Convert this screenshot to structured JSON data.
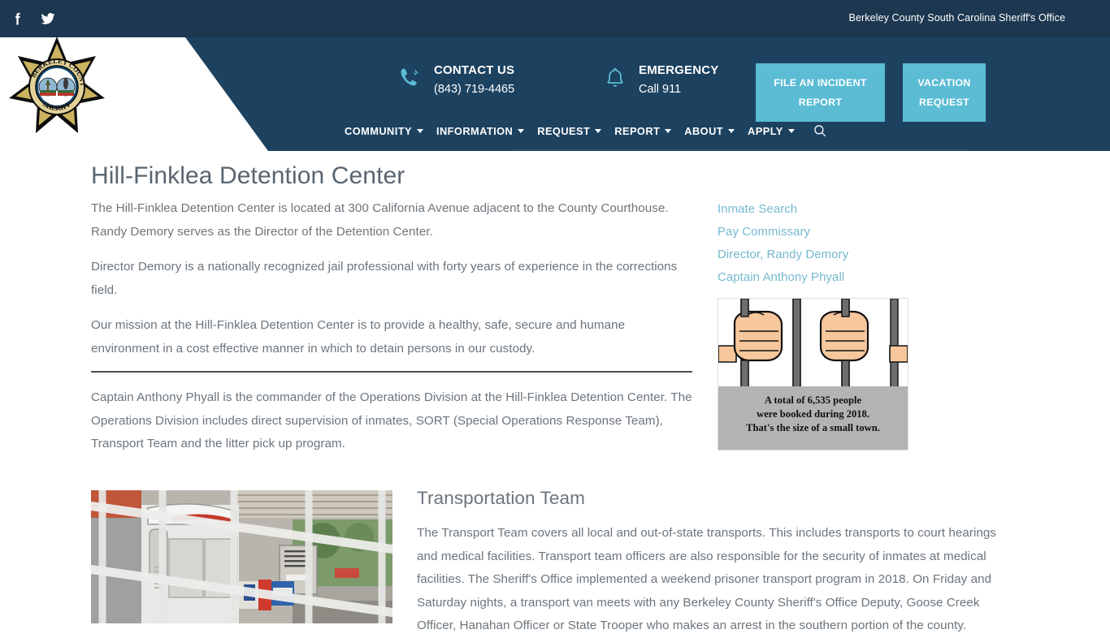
{
  "topbar": {
    "site_title": "Berkeley County South Carolina Sheriff's Office",
    "social": [
      {
        "name": "facebook-icon",
        "label": "Facebook"
      },
      {
        "name": "twitter-icon",
        "label": "Twitter"
      }
    ]
  },
  "header": {
    "logo_alt": "Berkeley County Sheriff Badge",
    "contact": {
      "heading": "CONTACT US",
      "phone": "(843) 719-4465",
      "icon": "phone-icon"
    },
    "emergency": {
      "heading": "EMERGENCY",
      "sub": "Call 911",
      "icon": "bell-icon"
    },
    "buttons": [
      {
        "label": "FILE AN INCIDENT REPORT",
        "color": "#5bbcd4"
      },
      {
        "label": "VACATION REQUEST",
        "color": "#5bbcd4"
      }
    ],
    "nav": [
      {
        "label": "COMMUNITY",
        "has_caret": true
      },
      {
        "label": "INFORMATION",
        "has_caret": true
      },
      {
        "label": "REQUEST",
        "has_caret": true
      },
      {
        "label": "REPORT",
        "has_caret": true
      },
      {
        "label": "ABOUT",
        "has_caret": true
      },
      {
        "label": "APPLY",
        "has_caret": true
      }
    ],
    "search_icon": "search-icon",
    "bg_color": "#1d4260",
    "topbar_color": "#1d3750"
  },
  "main": {
    "page_title": "Hill-Finklea Detention Center",
    "paragraphs": [
      "The Hill-Finklea Detention Center is located at 300 California Avenue adjacent to the County Courthouse. Randy Demory serves as the Director of the Detention Center.",
      "Director Demory is a nationally recognized jail professional with forty years of experience in the corrections field.",
      "Our mission at the Hill-Finklea Detention Center is to provide a healthy, safe, secure and humane environment in a cost effective manner in which to detain persons in our custody."
    ],
    "paragraph_after_rule": "Captain Anthony Phyall is the commander of the Operations Division at the Hill-Finklea Detention Center. The Operations Division includes direct supervision of inmates, SORT (Special Operations Response Team), Transport Team and the litter pick up program."
  },
  "sidebar": {
    "links": [
      {
        "label": "Inmate Search"
      },
      {
        "label": "Pay Commissary"
      },
      {
        "label": "Director, Randy Demory"
      },
      {
        "label": "Captain Anthony Phyall"
      }
    ],
    "link_color": "#76b9cf",
    "info_card": {
      "image_alt": "Hands gripping jail bars illustration",
      "caption_line1": "A total of 6,535 people",
      "caption_line2": "were booked during 2018.",
      "caption_line3": "That's the size of a small town."
    }
  },
  "transport": {
    "photo_alt": "Interior of prisoner transport van seen through metal cage",
    "title": "Transportation Team",
    "paragraph": "The Transport Team covers all local and out-of-state transports. This includes transports to court hearings and medical facilities. Transport team officers are also responsible for the security of inmates at medical facilities. The Sheriff's Office implemented a weekend prisoner transport program in 2018. On Friday and Saturday nights, a transport van meets with any Berkeley County Sheriff's Office Deputy, Goose Creek Officer, Hanahan Officer or State Trooper who makes an arrest in the southern portion of the county."
  }
}
